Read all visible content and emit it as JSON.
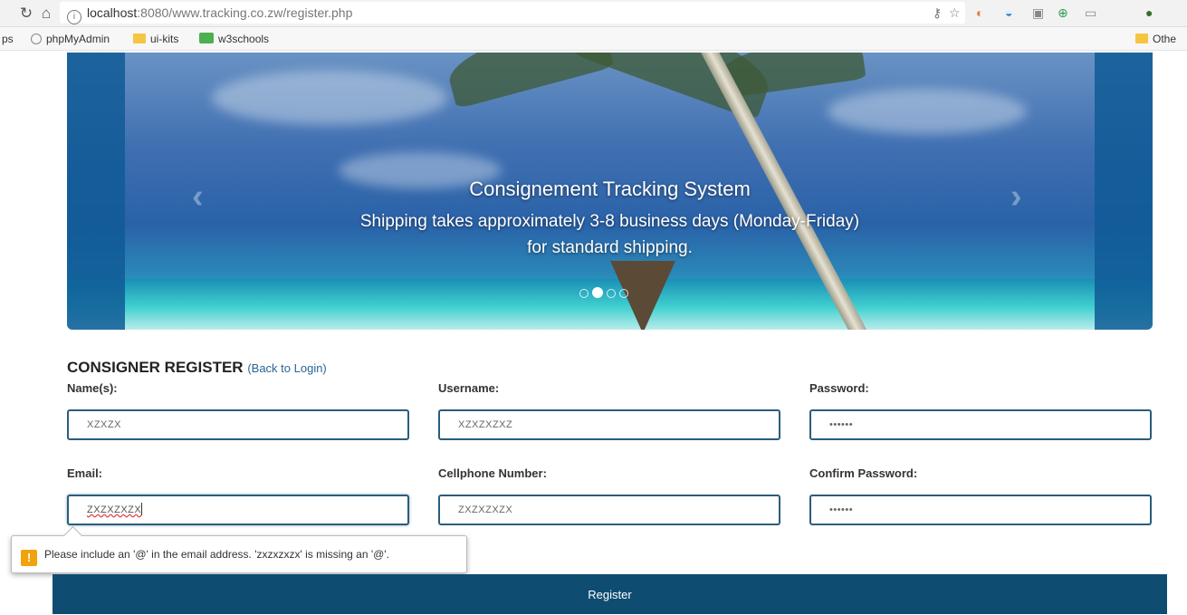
{
  "browser": {
    "url_host": "localhost",
    "url_rest": ":8080/www.tracking.co.zw/register.php",
    "bookmarks": [
      "ps",
      "phpMyAdmin",
      "ui-kits",
      "w3schools",
      "Othe"
    ]
  },
  "carousel": {
    "title": "Consignement Tracking System",
    "line1": "Shipping takes approximately 3-8 business days (Monday-Friday)",
    "line2": "for standard shipping.",
    "slide_count": 4,
    "active_slide": 2
  },
  "form": {
    "heading": "CONSIGNER REGISTER",
    "back_link": "(Back to Login)",
    "fields": {
      "name": {
        "label": "Name(s):",
        "value": "XZXZX"
      },
      "username": {
        "label": "Username:",
        "value": "XZXZXZXZ"
      },
      "password": {
        "label": "Password:",
        "value": "••••••"
      },
      "email": {
        "label": "Email:",
        "value": "ZXZXZXZX"
      },
      "cellphone": {
        "label": "Cellphone Number:",
        "value": "ZXZXZXZX"
      },
      "confirm_password": {
        "label": "Confirm Password:",
        "value": "••••••"
      }
    },
    "validation_message": "Please include an '@' in the email address. 'zxzxzxzx' is missing an '@'.",
    "submit_label": "Register"
  },
  "colors": {
    "primary": "#0e4c72",
    "field_border": "#2b5c7c",
    "warning": "#f0a30a"
  }
}
